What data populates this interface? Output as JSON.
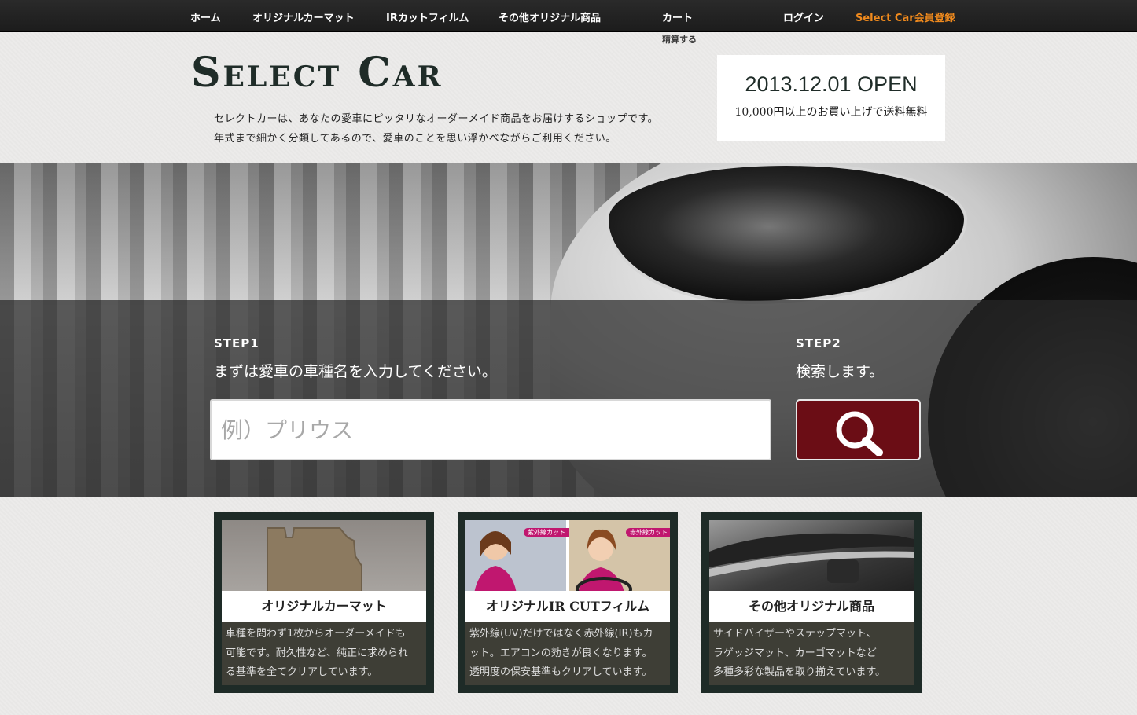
{
  "nav": {
    "items": [
      {
        "label": "ホーム"
      },
      {
        "label": "オリジナルカーマット"
      },
      {
        "label": "IRカットフィルム"
      },
      {
        "label": "その他オリジナル商品"
      },
      {
        "label": "カート"
      },
      {
        "label": "ログイン"
      },
      {
        "label": "Select Car会員登録"
      }
    ],
    "cart_sub": "精算する",
    "highlight_color": "#f08a1d"
  },
  "header": {
    "logo": "Select Car",
    "tagline_1": "セレクトカーは、あなたの愛車にピッタリなオーダーメイド商品をお届けするショップです。",
    "tagline_2": "年式まで細かく分類してあるので、愛車のことを思い浮かべながらご利用ください。",
    "open_title": "2013.12.01 OPEN",
    "open_sub": "10,000円以上のお買い上げで送料無料"
  },
  "search": {
    "step1_label": "STEP1",
    "step1_text": "まずは愛車の車種名を入力してください。",
    "step2_label": "STEP2",
    "step2_text": "検索します。",
    "placeholder": "例）プリウス",
    "button_icon": "search-icon",
    "button_color": "#6b0d15"
  },
  "cards": [
    {
      "title": "オリジナルカーマット",
      "desc": [
        "車種を問わず1枚からオーダーメイドも",
        "可能です。耐久性など、純正に求められ",
        "る基準を全てクリアしています。"
      ]
    },
    {
      "title": "オリジナルIR CUTフィルム",
      "badge_left": "紫外線カット",
      "badge_right": "赤外線カット",
      "desc": [
        "紫外線(UV)だけではなく赤外線(IR)もカ",
        "ット。エアコンの効きが良くなります。",
        "透明度の保安基準もクリアしています。"
      ]
    },
    {
      "title": "その他オリジナル商品",
      "desc": [
        "サイドバイザーやステップマット、",
        "ラゲッジマット、カーゴマットなど",
        "多種多彩な製品を取り揃えています。"
      ]
    }
  ]
}
